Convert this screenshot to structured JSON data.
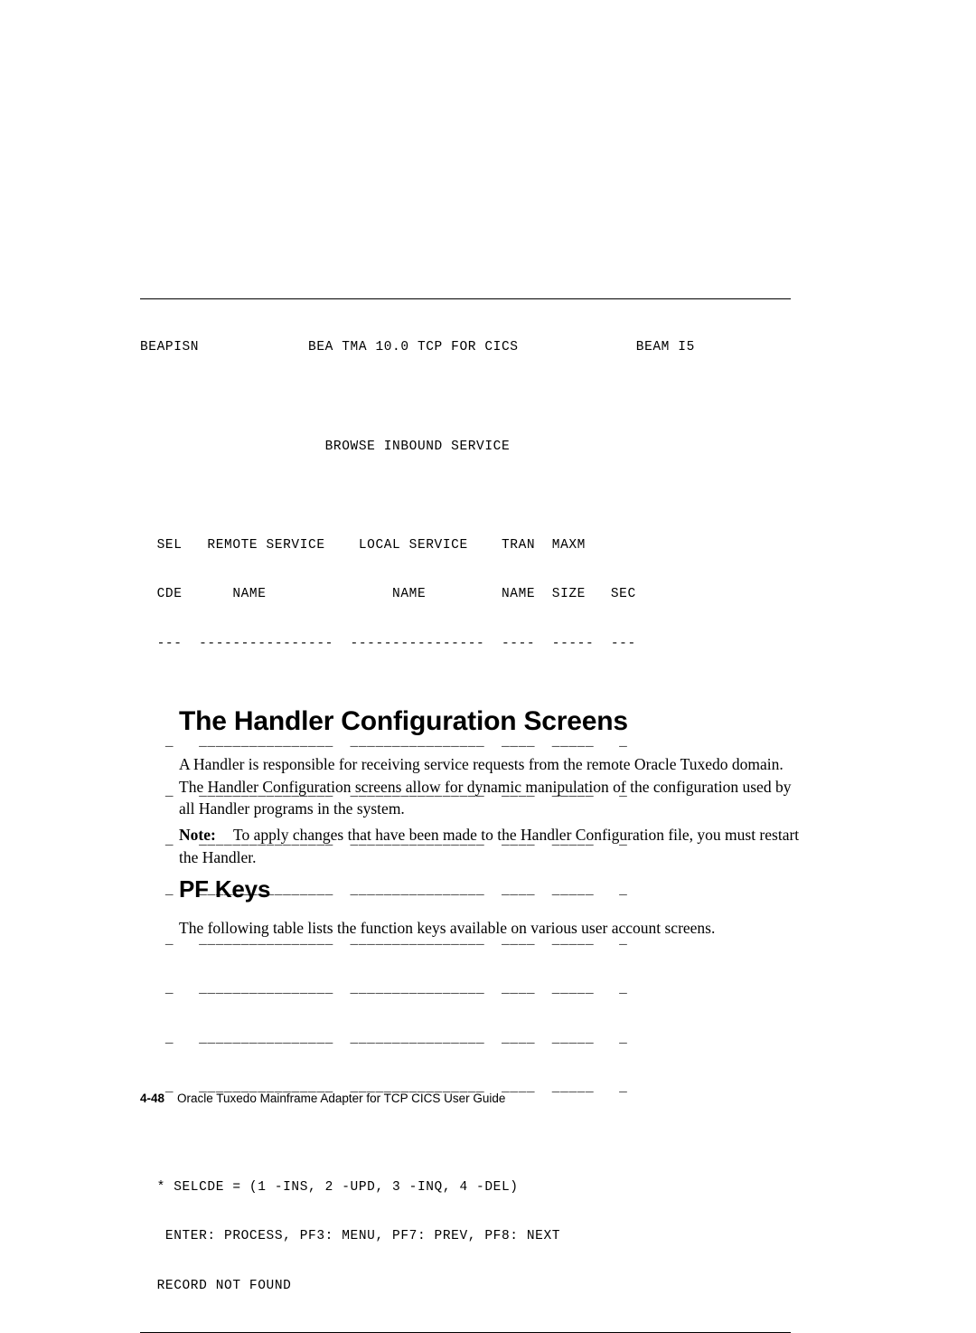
{
  "terminal": {
    "lines": [
      "BEAPISN             BEA TMA 10.0 TCP FOR CICS              BEAM I5",
      "",
      "                      BROWSE INBOUND SERVICE",
      "",
      "  SEL   REMOTE SERVICE    LOCAL SERVICE    TRAN  MAXM",
      "  CDE      NAME               NAME         NAME  SIZE   SEC",
      "  ---  ----------------  ----------------  ----  -----  ---"
    ],
    "field_row": "   _   ________________  ________________  ____  _____   _",
    "field_row_count": 8,
    "footer_lines": [
      "  * SELCDE = (1 -INS, 2 -UPD, 3 -INQ, 4 -DEL)",
      "   ENTER: PROCESS, PF3: MENU, PF7: PREV, PF8: NEXT",
      "  RECORD NOT FOUND"
    ]
  },
  "content": {
    "section_heading": "The Handler Configuration Screens",
    "handler_paragraph": "A Handler is responsible for receiving service requests from the remote Oracle Tuxedo domain. The Handler Configuration screens allow for dynamic manipulation of the configuration used by all Handler programs in the system.",
    "note_label": "Note:",
    "note_text": "To apply changes that have been made to the Handler Configuration file, you must restart the Handler.",
    "subsection_heading": "PF Keys",
    "pfkeys_paragraph": "The following table lists the function keys available on various user account screens."
  },
  "footer": {
    "page_number": "4-48",
    "book_title": "Oracle Tuxedo Mainframe Adapter for TCP CICS User Guide"
  }
}
